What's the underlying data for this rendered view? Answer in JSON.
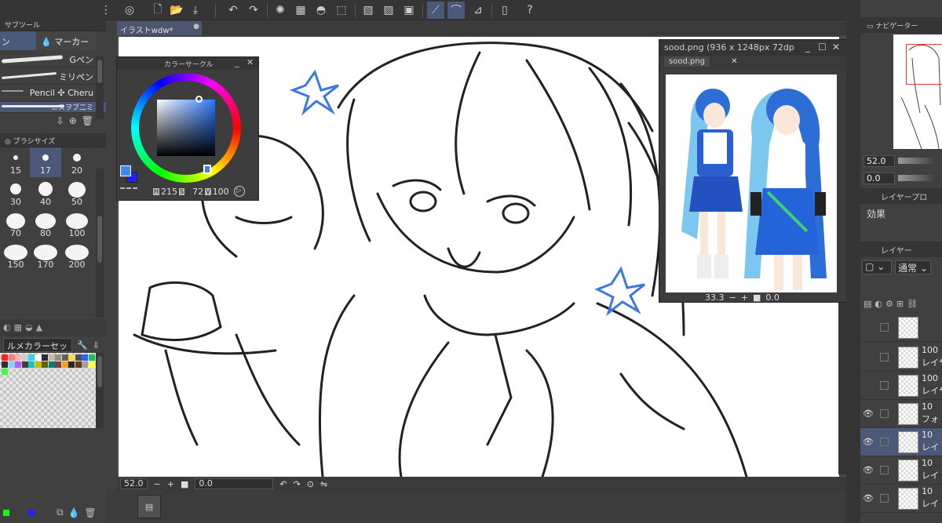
{
  "document": {
    "tab_title": "イラストwdw*"
  },
  "sub_tool": {
    "title": "サブツール",
    "tabs": [
      "ン",
      "マーカー"
    ],
    "brushes": [
      "Gペン",
      "ミリペン",
      "Pencil ✣ Cheru",
      "ニスヲブ二ミ"
    ]
  },
  "brush_size": {
    "title": "ブラシサイズ",
    "sizes": [
      "15",
      "17",
      "20",
      "30",
      "40",
      "50",
      "70",
      "80",
      "100",
      "150",
      "170",
      "200"
    ],
    "selected": "17"
  },
  "color_set": {
    "name": "ルメカラーセット"
  },
  "color_circle": {
    "title": "カラーサークル",
    "h_label": "H",
    "h": "215",
    "s_label": "S",
    "s": "72",
    "v_label": "V",
    "v": "100",
    "main_color": "#3d8bf0",
    "sub_color": "#2020ff"
  },
  "reference": {
    "title": "sood.png (936 x 1248px 72dp",
    "tab": "sood.png",
    "zoom": "33.3",
    "rotation": "0.0"
  },
  "canvas_status": {
    "zoom": "52.0",
    "rotation": "0.0"
  },
  "navigator": {
    "title": "ナビゲーター",
    "zoom": "52.0",
    "rotation": "0.0"
  },
  "layer_property": {
    "title": "レイヤープロ",
    "effect_label": "効果"
  },
  "layers_panel": {
    "title": "レイヤー",
    "blend_mode": "通常",
    "layers": [
      {
        "opacity": "",
        "name": ""
      },
      {
        "opacity": "100",
        "name": "レイヤ"
      },
      {
        "opacity": "100",
        "name": "レイヤ"
      },
      {
        "opacity": "10",
        "name": "フォ"
      },
      {
        "opacity": "10",
        "name": "レイ"
      },
      {
        "opacity": "10",
        "name": "レイ"
      },
      {
        "opacity": "10",
        "name": "レイ"
      }
    ]
  },
  "colors": {
    "selection": "#4b5878",
    "accent": "#3d8bf0",
    "panel": "#404040"
  }
}
